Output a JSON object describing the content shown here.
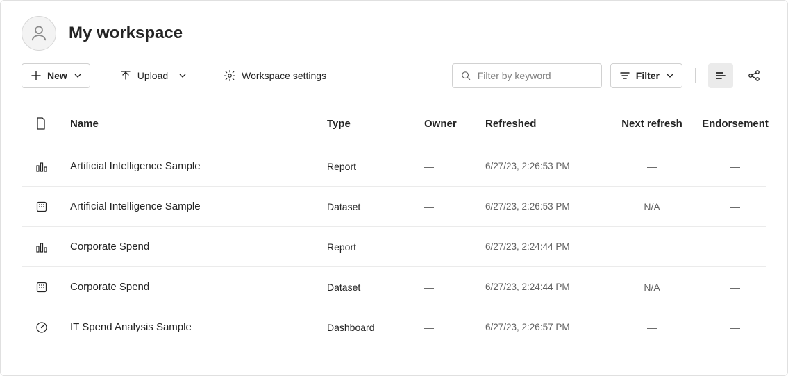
{
  "header": {
    "title": "My workspace"
  },
  "toolbar": {
    "new_label": "New",
    "upload_label": "Upload",
    "settings_label": "Workspace settings",
    "filter_label": "Filter",
    "search_placeholder": "Filter by keyword"
  },
  "table": {
    "columns": {
      "name": "Name",
      "type": "Type",
      "owner": "Owner",
      "refreshed": "Refreshed",
      "next_refresh": "Next refresh",
      "endorsement": "Endorsement"
    },
    "rows": [
      {
        "icon": "report",
        "name": "Artificial Intelligence Sample",
        "type": "Report",
        "owner": "—",
        "refreshed": "6/27/23, 2:26:53 PM",
        "next_refresh": "—",
        "endorsement": "—"
      },
      {
        "icon": "dataset",
        "name": "Artificial Intelligence Sample",
        "type": "Dataset",
        "owner": "—",
        "refreshed": "6/27/23, 2:26:53 PM",
        "next_refresh": "N/A",
        "endorsement": "—"
      },
      {
        "icon": "report",
        "name": "Corporate Spend",
        "type": "Report",
        "owner": "—",
        "refreshed": "6/27/23, 2:24:44 PM",
        "next_refresh": "—",
        "endorsement": "—"
      },
      {
        "icon": "dataset",
        "name": "Corporate Spend",
        "type": "Dataset",
        "owner": "—",
        "refreshed": "6/27/23, 2:24:44 PM",
        "next_refresh": "N/A",
        "endorsement": "—"
      },
      {
        "icon": "dashboard",
        "name": "IT Spend Analysis Sample",
        "type": "Dashboard",
        "owner": "—",
        "refreshed": "6/27/23, 2:26:57 PM",
        "next_refresh": "—",
        "endorsement": "—"
      }
    ]
  }
}
